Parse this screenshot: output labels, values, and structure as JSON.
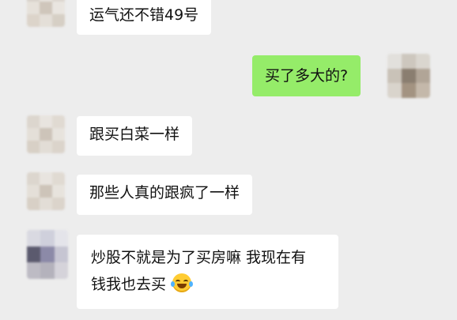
{
  "chat": {
    "messages": [
      {
        "sender": "other",
        "text": "运气还不错49号"
      },
      {
        "sender": "me",
        "text": "买了多大的?"
      },
      {
        "sender": "other",
        "text": "跟买白菜一样"
      },
      {
        "sender": "other",
        "text": "那些人真的跟疯了一样"
      },
      {
        "sender": "other",
        "line1": "炒股不就是为了买房嘛 我现在有",
        "line2": "钱我也去买",
        "emoji": "laughing-with-tears-emoji"
      }
    ]
  },
  "colors": {
    "background": "#ededed",
    "bubble_other": "#ffffff",
    "bubble_me": "#95ec69",
    "text": "#111111"
  }
}
